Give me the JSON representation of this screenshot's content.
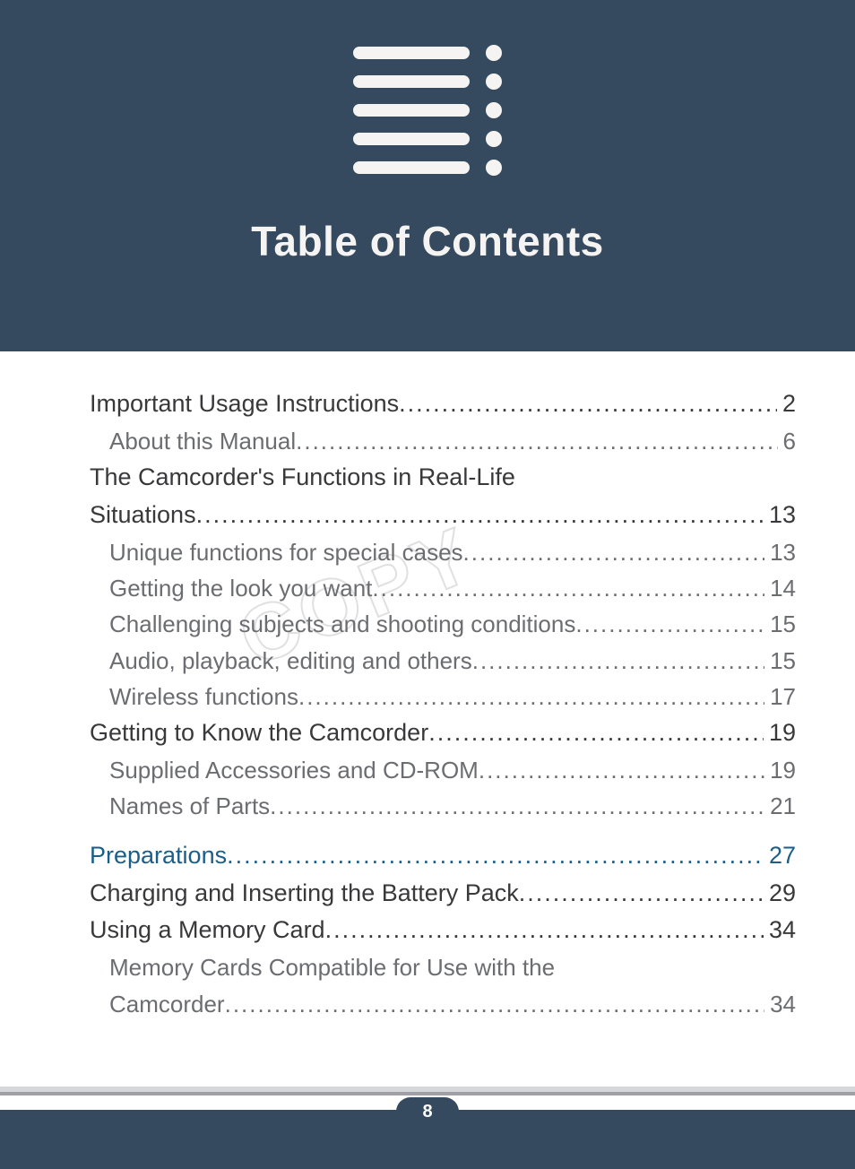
{
  "header": {
    "title": "Table of Contents"
  },
  "watermark": "COPY",
  "page_number": "8",
  "toc": [
    {
      "level": 1,
      "label": "Important Usage Instructions",
      "page": "2"
    },
    {
      "level": 2,
      "label": "About this Manual",
      "page": "6"
    },
    {
      "level": 1,
      "label_line1": "The Camcorder's Functions in Real-Life",
      "label_line2": "Situations",
      "page": "13",
      "wrap": true
    },
    {
      "level": 2,
      "label": "Unique functions for special cases",
      "page": "13"
    },
    {
      "level": 2,
      "label": "Getting the look you want",
      "page": "14"
    },
    {
      "level": 2,
      "label": "Challenging subjects and shooting conditions",
      "page": "15"
    },
    {
      "level": 2,
      "label": "Audio, playback, editing and others",
      "page": "15"
    },
    {
      "level": 2,
      "label": "Wireless functions",
      "page": "17"
    },
    {
      "level": 1,
      "label": "Getting to Know the Camcorder",
      "page": "19"
    },
    {
      "level": 2,
      "label": "Supplied Accessories and CD-ROM",
      "page": "19"
    },
    {
      "level": 2,
      "label": "Names of Parts",
      "page": "21"
    },
    {
      "level": "chapter",
      "label": "Preparations",
      "page": "27"
    },
    {
      "level": 1,
      "label": "Charging and Inserting the Battery Pack",
      "page": "29"
    },
    {
      "level": 1,
      "label": "Using a Memory Card",
      "page": "34"
    },
    {
      "level": 2,
      "label_line1": "Memory Cards Compatible for Use with the",
      "label_line2": "Camcorder",
      "page": "34",
      "wrap": true
    }
  ]
}
